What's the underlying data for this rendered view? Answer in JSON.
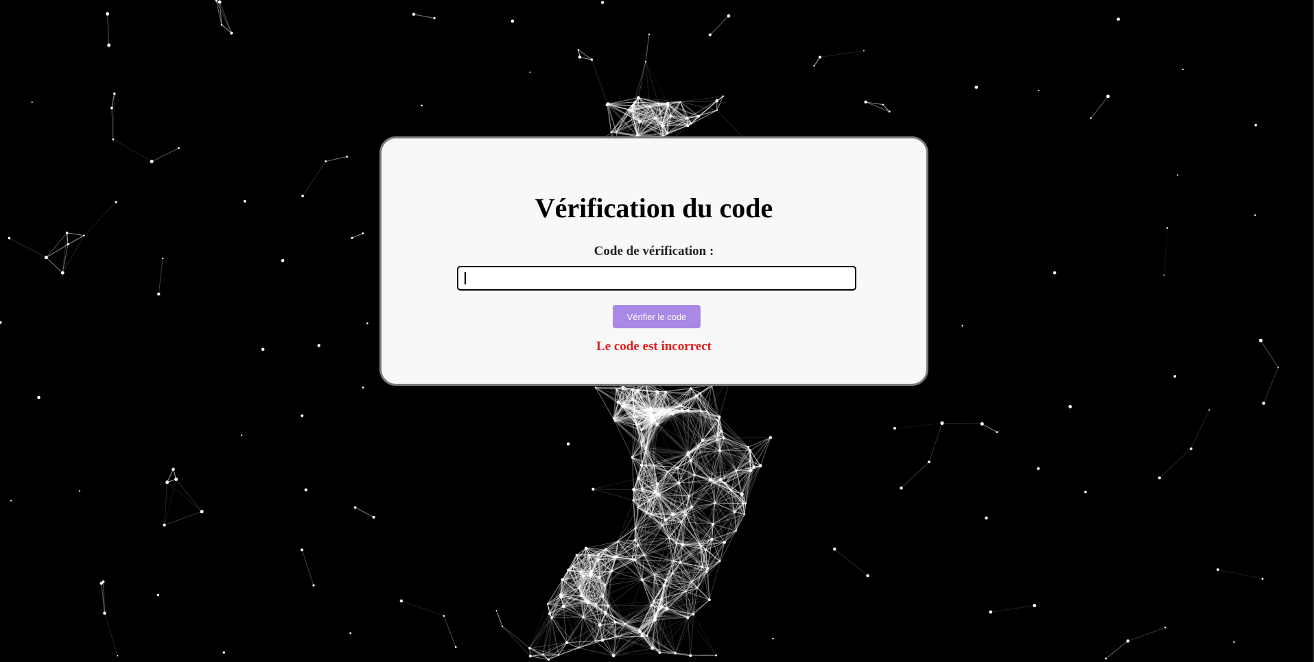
{
  "page": {
    "background_color": "#000000",
    "particle_color": "#ffffff"
  },
  "card": {
    "title": "Vérification du code",
    "field_label": "Code de vérification :",
    "input_value": "",
    "button_label": "Vérifier le code",
    "error_message": "Le code est incorrect",
    "card_color": "#f8f8f8",
    "button_color": "#a988e6",
    "error_color": "#e31b1b"
  }
}
